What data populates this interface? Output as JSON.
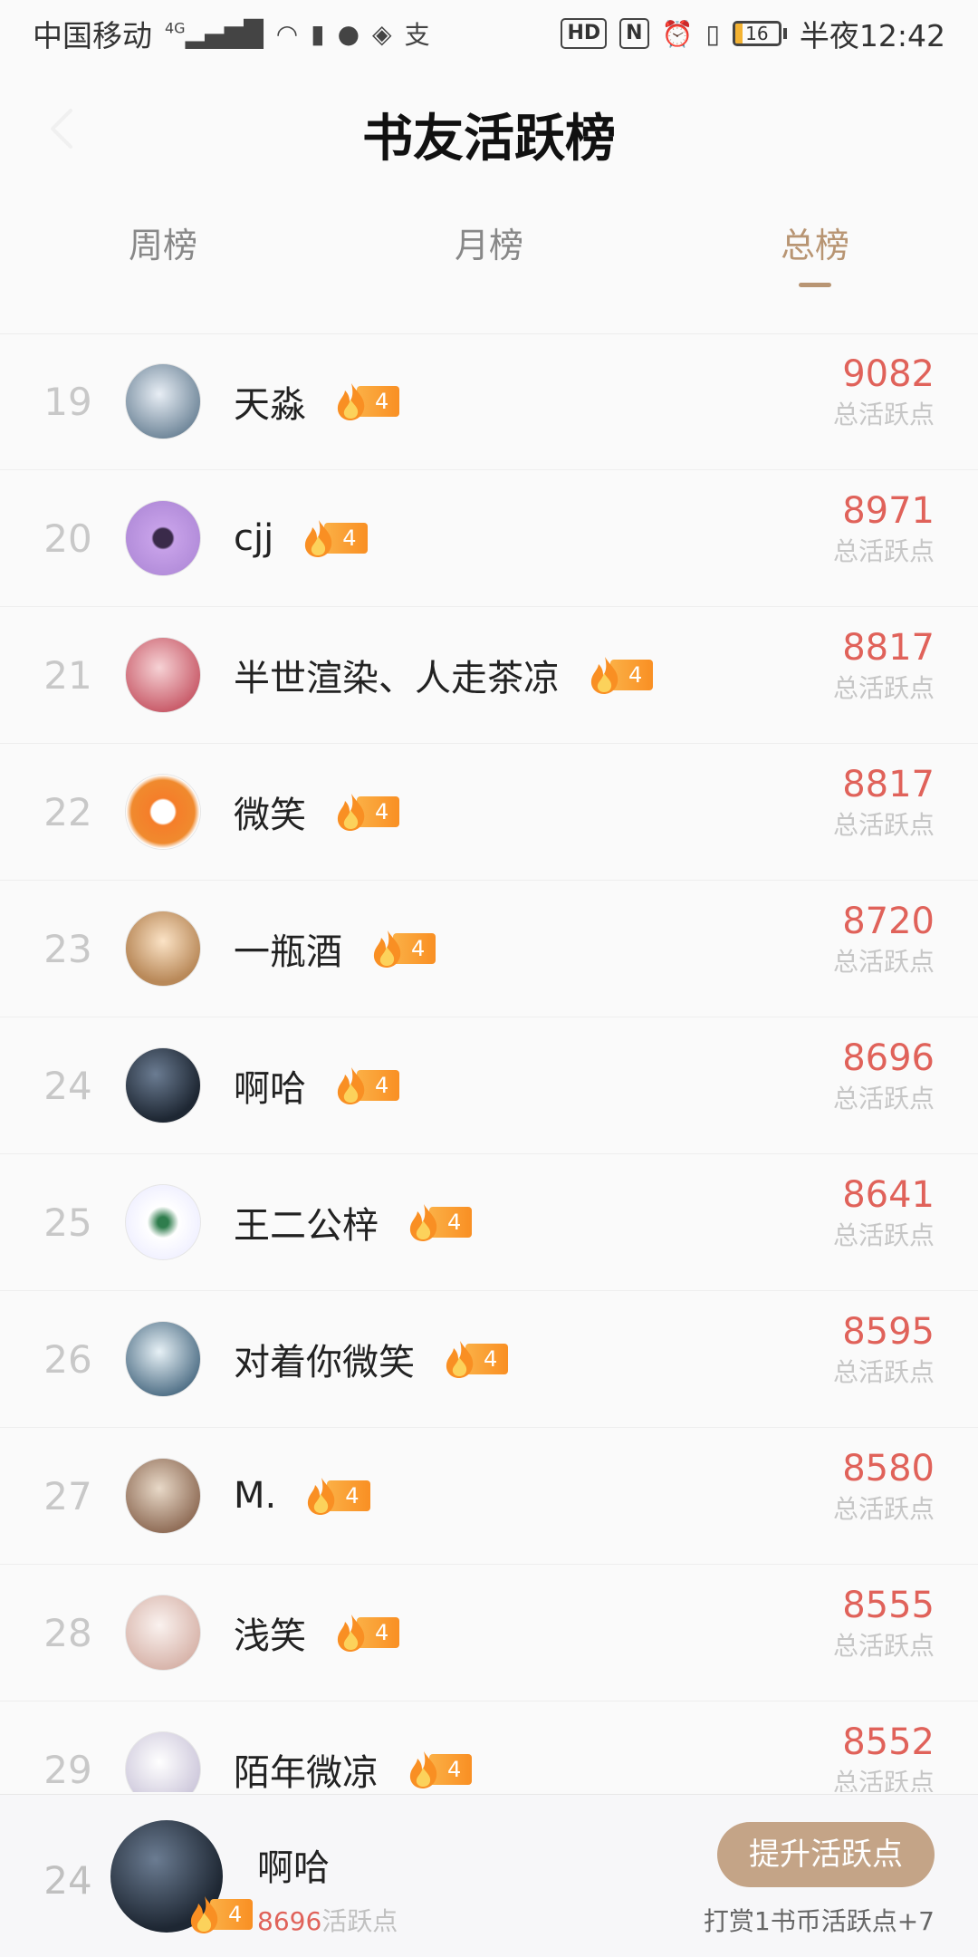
{
  "status_bar": {
    "carrier": "中国移动",
    "network": "4G",
    "hd": "HD",
    "nfc": "N",
    "battery_level": "16",
    "time": "半夜12:42"
  },
  "header": {
    "title": "书友活跃榜"
  },
  "tabs": [
    {
      "label": "周榜",
      "active": false
    },
    {
      "label": "月榜",
      "active": false
    },
    {
      "label": "总榜",
      "active": true
    }
  ],
  "rank_list": [
    {
      "rank": "19",
      "name": "天淼",
      "level": "4",
      "score": "9082",
      "score_label": "总活跃点"
    },
    {
      "rank": "20",
      "name": "cjj",
      "level": "4",
      "score": "8971",
      "score_label": "总活跃点"
    },
    {
      "rank": "21",
      "name": "半世渲染、人走茶凉",
      "level": "4",
      "score": "8817",
      "score_label": "总活跃点"
    },
    {
      "rank": "22",
      "name": "微笑",
      "level": "4",
      "score": "8817",
      "score_label": "总活跃点"
    },
    {
      "rank": "23",
      "name": "一瓶酒",
      "level": "4",
      "score": "8720",
      "score_label": "总活跃点"
    },
    {
      "rank": "24",
      "name": "啊哈",
      "level": "4",
      "score": "8696",
      "score_label": "总活跃点"
    },
    {
      "rank": "25",
      "name": "王二公梓",
      "level": "4",
      "score": "8641",
      "score_label": "总活跃点"
    },
    {
      "rank": "26",
      "name": "对着你微笑",
      "level": "4",
      "score": "8595",
      "score_label": "总活跃点"
    },
    {
      "rank": "27",
      "name": "M.",
      "level": "4",
      "score": "8580",
      "score_label": "总活跃点"
    },
    {
      "rank": "28",
      "name": "浅笑",
      "level": "4",
      "score": "8555",
      "score_label": "总活跃点"
    },
    {
      "rank": "29",
      "name": "陌年微凉",
      "level": "4",
      "score": "8552",
      "score_label": "总活跃点"
    }
  ],
  "my_rank": {
    "rank": "24",
    "name": "啊哈",
    "level": "4",
    "points": "8696",
    "points_label": "活跃点",
    "boost_button": "提升活跃点",
    "boost_note": "打赏1书币活跃点+7"
  },
  "colors": {
    "accent": "#b89573",
    "score": "#e0625a",
    "badge": "#f98f23",
    "button": "#c4a487"
  }
}
